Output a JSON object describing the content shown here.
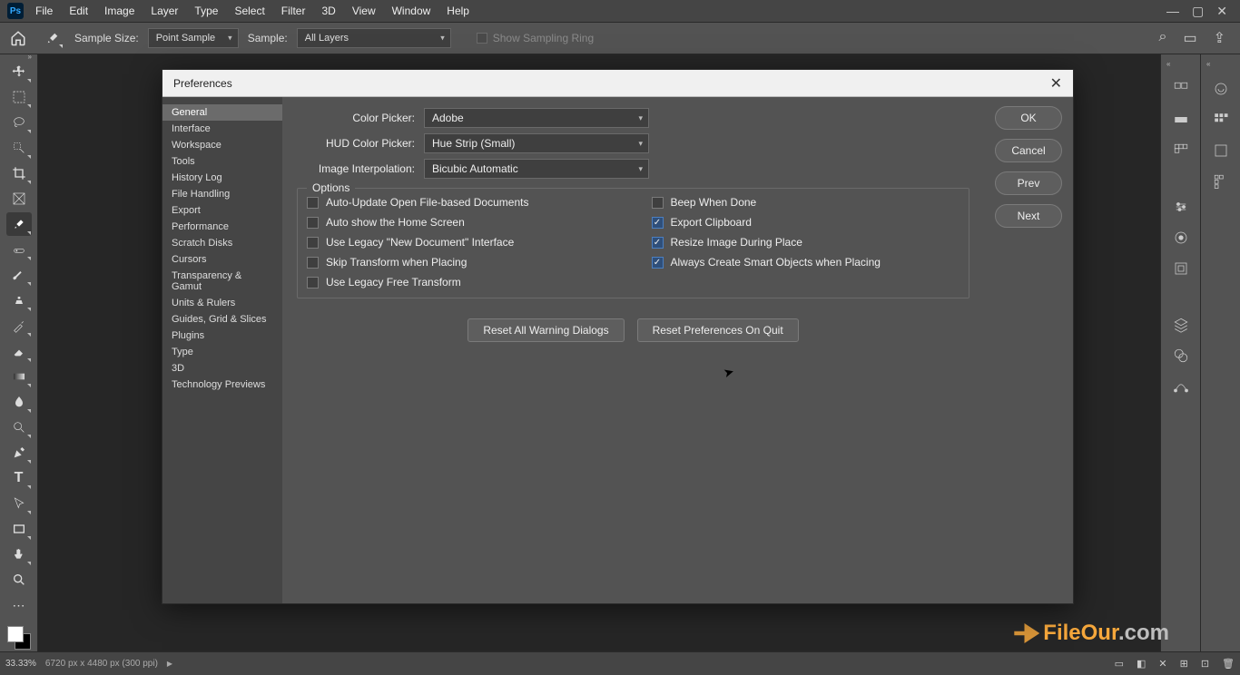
{
  "menubar": {
    "items": [
      "File",
      "Edit",
      "Image",
      "Layer",
      "Type",
      "Select",
      "Filter",
      "3D",
      "View",
      "Window",
      "Help"
    ]
  },
  "optionsbar": {
    "sample_size_label": "Sample Size:",
    "sample_size_value": "Point Sample",
    "sample_label": "Sample:",
    "sample_value": "All Layers",
    "show_sampling_ring": "Show Sampling Ring"
  },
  "dialog": {
    "title": "Preferences",
    "sidebar": [
      "General",
      "Interface",
      "Workspace",
      "Tools",
      "History Log",
      "File Handling",
      "Export",
      "Performance",
      "Scratch Disks",
      "Cursors",
      "Transparency & Gamut",
      "Units & Rulers",
      "Guides, Grid & Slices",
      "Plugins",
      "Type",
      "3D",
      "Technology Previews"
    ],
    "sidebar_selected": 0,
    "buttons": {
      "ok": "OK",
      "cancel": "Cancel",
      "prev": "Prev",
      "next": "Next"
    },
    "fields": {
      "color_picker_label": "Color Picker:",
      "color_picker_value": "Adobe",
      "hud_label": "HUD Color Picker:",
      "hud_value": "Hue Strip (Small)",
      "interp_label": "Image Interpolation:",
      "interp_value": "Bicubic Automatic"
    },
    "options_legend": "Options",
    "options": [
      {
        "label": "Auto-Update Open File-based Documents",
        "checked": false
      },
      {
        "label": "Beep When Done",
        "checked": false
      },
      {
        "label": "Auto show the Home Screen",
        "checked": false
      },
      {
        "label": "Export Clipboard",
        "checked": true
      },
      {
        "label": "Use Legacy \"New Document\" Interface",
        "checked": false
      },
      {
        "label": "Resize Image During Place",
        "checked": true
      },
      {
        "label": "Skip Transform when Placing",
        "checked": false
      },
      {
        "label": "Always Create Smart Objects when Placing",
        "checked": true
      },
      {
        "label": "Use Legacy Free Transform",
        "checked": false
      }
    ],
    "reset_warnings": "Reset All Warning Dialogs",
    "reset_prefs": "Reset Preferences On Quit"
  },
  "statusbar": {
    "zoom": "33.33%",
    "doc": "6720 px x 4480 px (300 ppi)"
  },
  "watermark": {
    "part1": "FileOur",
    "part2": ".com"
  }
}
